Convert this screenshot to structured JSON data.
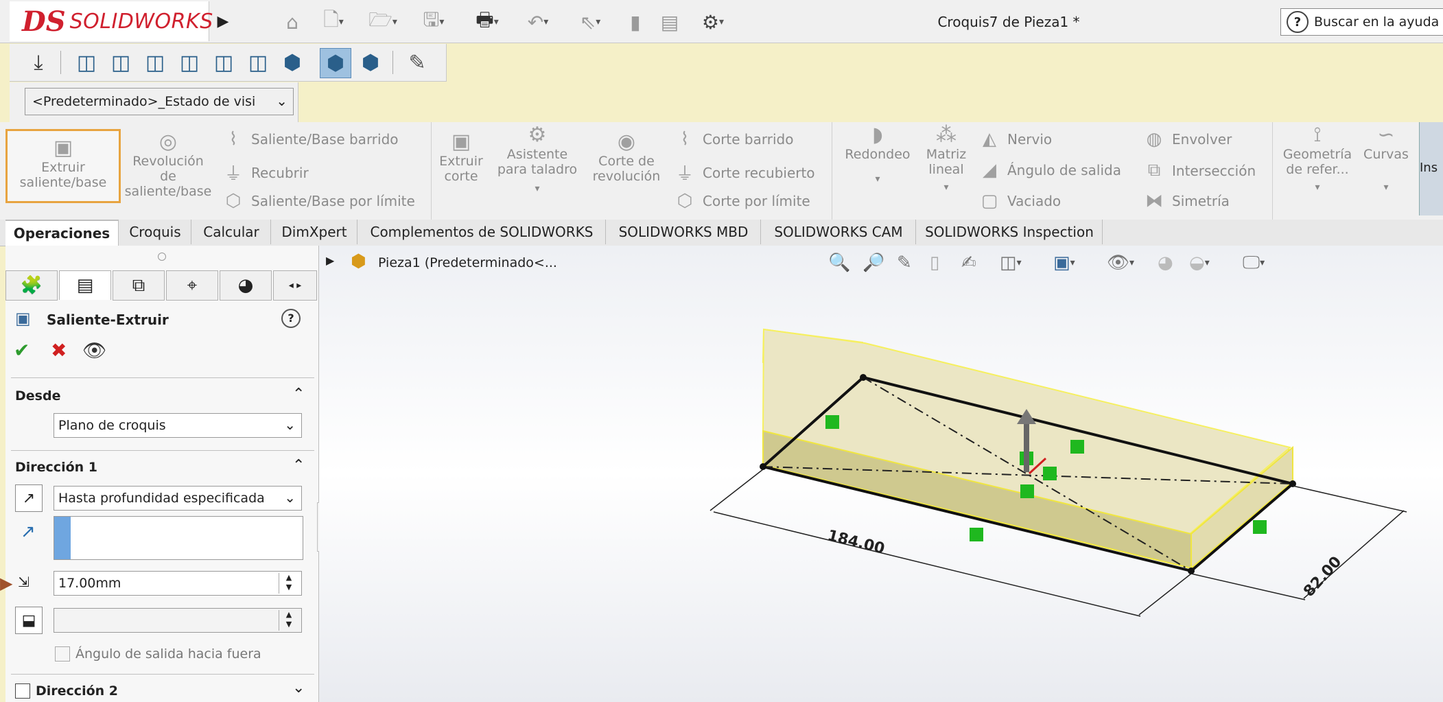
{
  "app": {
    "logo_text": "SOLIDWORKS",
    "logo_ds": "DS",
    "title": "Croquis7 de Pieza1 *",
    "search_placeholder": "Buscar en la ayuda"
  },
  "config": {
    "selected": "<Predeterminado>_Estado de visi"
  },
  "command_manager": {
    "extrude_boss": "Extruir saliente/base",
    "revolve_boss": "Revolución de saliente/base",
    "swept_boss": "Saliente/Base barrido",
    "loft": "Recubrir",
    "boundary_boss": "Saliente/Base por límite",
    "extrude_cut": "Extruir corte",
    "hole_wizard": "Asistente para taladro",
    "revolve_cut": "Corte de revolución",
    "swept_cut": "Corte barrido",
    "lofted_cut": "Corte recubierto",
    "boundary_cut": "Corte por límite",
    "fillet": "Redondeo",
    "linear_pattern": "Matriz lineal",
    "rib": "Nervio",
    "draft": "Ángulo de salida",
    "shell": "Vaciado",
    "wrap": "Envolver",
    "intersect": "Intersección",
    "mirror": "Simetría",
    "ref_geometry": "Geometría de refer...",
    "curves": "Curvas",
    "instant3d": "Ins"
  },
  "tabs": [
    "Operaciones",
    "Croquis",
    "Calcular",
    "DimXpert",
    "Complementos de SOLIDWORKS",
    "SOLIDWORKS MBD",
    "SOLIDWORKS CAM",
    "SOLIDWORKS Inspection"
  ],
  "property_manager": {
    "title": "Saliente-Extruir",
    "from_label": "Desde",
    "from_value": "Plano de croquis",
    "direction1_label": "Dirección 1",
    "end_condition": "Hasta profundidad especificada",
    "depth_value": "17.00mm",
    "draft_outward": "Ángulo de salida hacia fuera",
    "direction2_label": "Dirección 2"
  },
  "tree": {
    "part_label": "Pieza1  (Predeterminado<..."
  },
  "model": {
    "dim_length": "184.00",
    "dim_width": "82.00"
  }
}
